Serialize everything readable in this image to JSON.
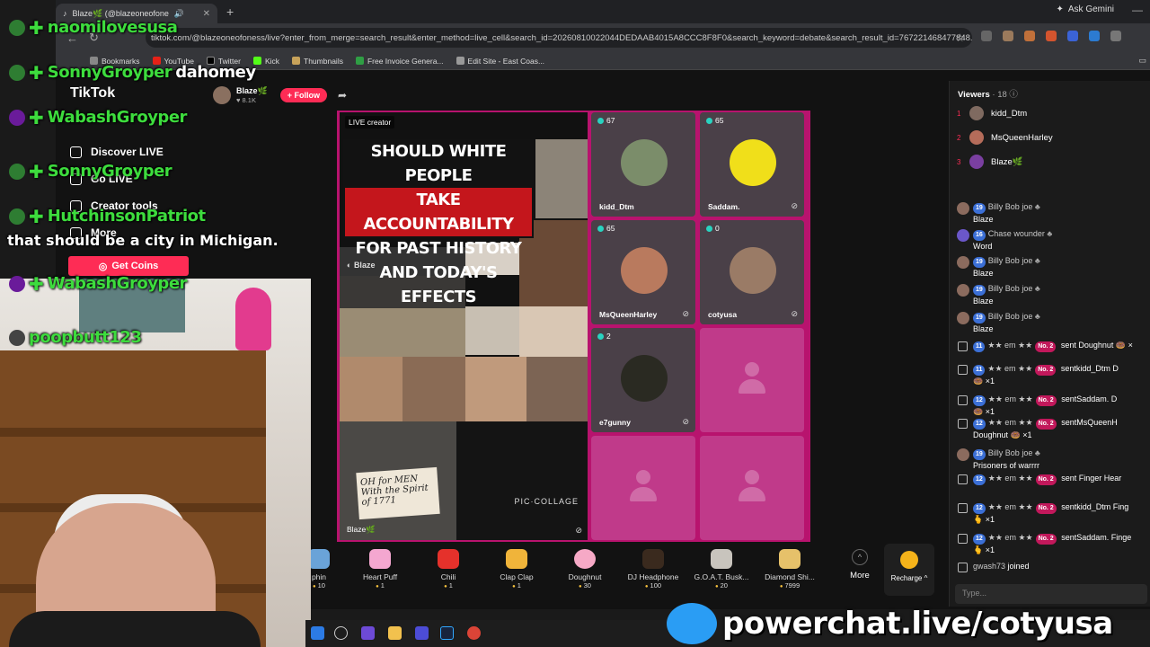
{
  "browser": {
    "tab_title": "Blaze🌿 (@blazeoneofone",
    "address": "tiktok.com/@blazeoneofoness/live?enter_from_merge=search_result&enter_method=live_cell&search_id=20260810022044DEDAAB4015A8CCC8F8F0&search_keyword=debate&search_result_id=767221468477848...",
    "gemini": "Ask Gemini",
    "bookmarks": [
      "Bookmarks",
      "YouTube",
      "Twitter",
      "Kick",
      "Thumbnails",
      "Free Invoice Genera...",
      "Edit Site - East Coas..."
    ],
    "colors": {
      "tab_bg": "#35363a",
      "chrome_bg": "#202124"
    }
  },
  "sidebar": {
    "logo": "TikTok",
    "items": [
      "Discover LIVE",
      "Go LIVE",
      "Creator tools",
      "More"
    ],
    "get_coins": "Get Coins"
  },
  "host": {
    "name": "Blaze🌿",
    "likes": "♥ 8.1K",
    "follow": "+ Follow"
  },
  "stream": {
    "live_label": "LIVE creator",
    "title_lines": [
      "SHOULD WHITE PEOPLE",
      "TAKE ACCOUNTABILITY",
      "FOR PAST HISTORY",
      "AND TODAY'S EFFECTS"
    ],
    "watermark": "Blaze",
    "sign_text": "OH for MEN With the Spirit of 1771",
    "collage_tag": "PIC·COLLAGE",
    "host_tag": "Blaze🌿",
    "accent": "#b8136e"
  },
  "guests": [
    {
      "count": "67",
      "name": "kidd_Dtm"
    },
    {
      "count": "65",
      "name": "Saddam."
    },
    {
      "count": "65",
      "name": "MsQueenHarley"
    },
    {
      "count": "0",
      "name": "cotyusa"
    },
    {
      "count": "2",
      "name": "e7gunny"
    }
  ],
  "gifts": [
    {
      "name": "phin",
      "price": "10"
    },
    {
      "name": "Heart Puff",
      "price": "1"
    },
    {
      "name": "Chili",
      "price": "1"
    },
    {
      "name": "Clap Clap",
      "price": "1"
    },
    {
      "name": "Doughnut",
      "price": "30"
    },
    {
      "name": "DJ Headphone",
      "price": "100"
    },
    {
      "name": "G.O.A.T. Busk...",
      "price": "20"
    },
    {
      "name": "Diamond Shi...",
      "price": "7999"
    }
  ],
  "gift_more": "More",
  "recharge": "Recharge ^",
  "viewers": {
    "title": "Viewers",
    "count": "· 18",
    "list": [
      {
        "rank": "1",
        "name": "kidd_Dtm"
      },
      {
        "rank": "2",
        "name": "MsQueenHarley"
      },
      {
        "rank": "3",
        "name": "Blaze🌿"
      }
    ]
  },
  "chat": [
    {
      "kind": "msg",
      "lvl": "19",
      "user": "Billy Bob joe",
      "text": "Blaze"
    },
    {
      "kind": "msg",
      "lvl": "16",
      "user": "Chase wounder",
      "text": "Word"
    },
    {
      "kind": "msg",
      "lvl": "19",
      "user": "Billy Bob joe",
      "text": "Blaze"
    },
    {
      "kind": "msg",
      "lvl": "19",
      "user": "Billy Bob joe",
      "text": "Blaze"
    },
    {
      "kind": "msg",
      "lvl": "19",
      "user": "Billy Bob joe",
      "text": "Blaze"
    },
    {
      "kind": "gift",
      "lvl": "11",
      "user": "★★ em ★★",
      "rank": "No. 2",
      "text": "sent Doughnut 🍩 ×"
    },
    {
      "kind": "gift",
      "lvl": "11",
      "user": "★★ em ★★",
      "rank": "No. 2",
      "text": "sentkidd_Dtm D",
      "extra": "🍩 ×1"
    },
    {
      "kind": "gift",
      "lvl": "12",
      "user": "★★ em ★★",
      "rank": "No. 2",
      "text": "sentSaddam. D",
      "extra": "🍩 ×1"
    },
    {
      "kind": "gift",
      "lvl": "12",
      "user": "★★ em ★★",
      "rank": "No. 2",
      "text": "sentMsQueenH",
      "extra": "Doughnut 🍩 ×1"
    },
    {
      "kind": "msg",
      "lvl": "19",
      "user": "Billy Bob joe",
      "text": "Prisoners of warrrr"
    },
    {
      "kind": "gift",
      "lvl": "12",
      "user": "★★ em ★★",
      "rank": "No. 2",
      "text": "sent Finger Hear"
    },
    {
      "kind": "gift",
      "lvl": "12",
      "user": "★★ em ★★",
      "rank": "No. 2",
      "text": "sentkidd_Dtm Fing",
      "extra": "🫰 ×1"
    },
    {
      "kind": "gift",
      "lvl": "12",
      "user": "★★ em ★★",
      "rank": "No. 2",
      "text": "sentSaddam. Finge",
      "extra": "🫰 ×1"
    },
    {
      "kind": "join",
      "user": "gwash73",
      "text": "joined"
    }
  ],
  "chat_placeholder": "Type...",
  "overlay_chat": [
    {
      "name": "naomilovesusa",
      "text": ""
    },
    {
      "name": "SonnyGroyper",
      "text": "dahomey"
    },
    {
      "name": "WabashGroyper",
      "text": ""
    },
    {
      "name": "SonnyGroyper",
      "text": ""
    },
    {
      "name": "HutchinsonPatriot",
      "text": ""
    },
    {
      "name": "WabashGroyper",
      "text": ""
    },
    {
      "name": "poopbutt123",
      "text": ""
    }
  ],
  "overlay_message": "that should be a city in Michigan.",
  "powerchat": "powerchat.live/cotyusa"
}
